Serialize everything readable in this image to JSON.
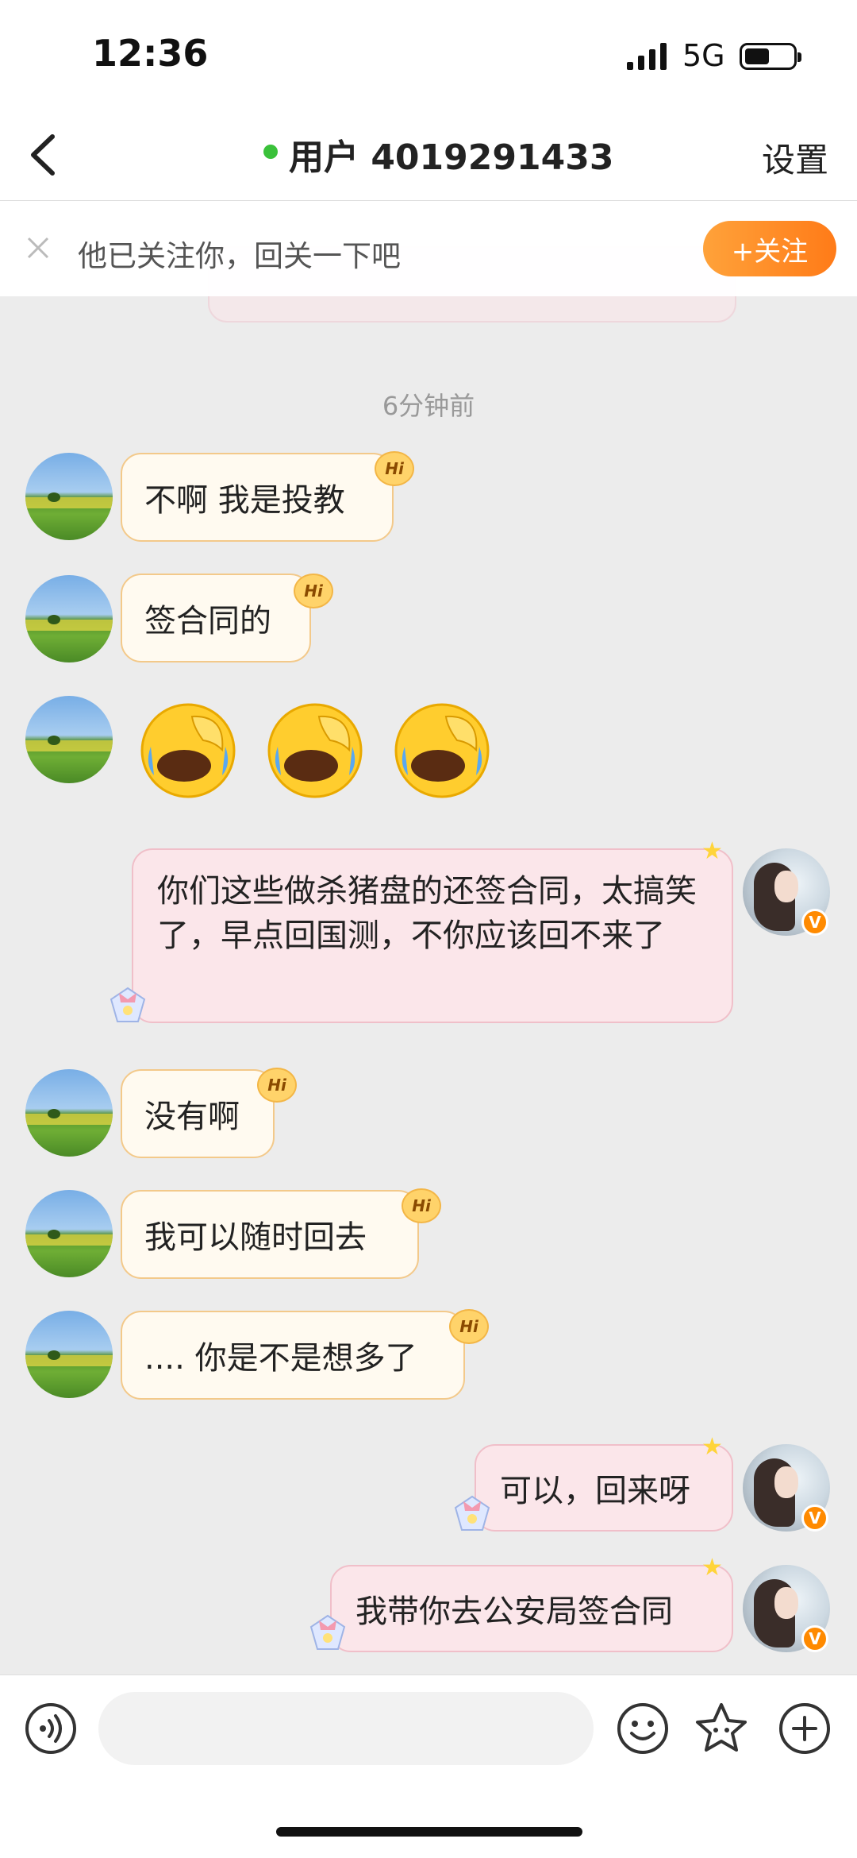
{
  "status_bar": {
    "time": "12:36",
    "network": "5G"
  },
  "header": {
    "title": "用户 4019291433",
    "settings_label": "设置"
  },
  "follow_bar": {
    "text": "他已关注你，回关一下吧",
    "button_label": "+关注"
  },
  "chat": {
    "timestamp": "6分钟前",
    "messages": [
      {
        "side": "left",
        "text": "不啊 我是投教"
      },
      {
        "side": "left",
        "text": "签合同的"
      },
      {
        "side": "left",
        "type": "emoji",
        "emoji": "😂",
        "count": 3
      },
      {
        "side": "right",
        "text": "你们这些做杀猪盘的还签合同，太搞笑了，早点回国测，不你应该回不来了"
      },
      {
        "side": "left",
        "text": "没有啊"
      },
      {
        "side": "left",
        "text": "我可以随时回去"
      },
      {
        "side": "left",
        "text": ".... 你是不是想多了"
      },
      {
        "side": "right",
        "text": "可以，回来呀"
      },
      {
        "side": "right",
        "text": "我带你去公安局签合同"
      }
    ]
  },
  "badges": {
    "hi": "Hi",
    "verified": "V"
  },
  "input_bar": {
    "placeholder": ""
  },
  "colors": {
    "accent_orange": "#ff8a1e",
    "online_green": "#3ac13a",
    "right_bubble": "#fbe6ea",
    "left_bubble": "#fffaf0"
  }
}
